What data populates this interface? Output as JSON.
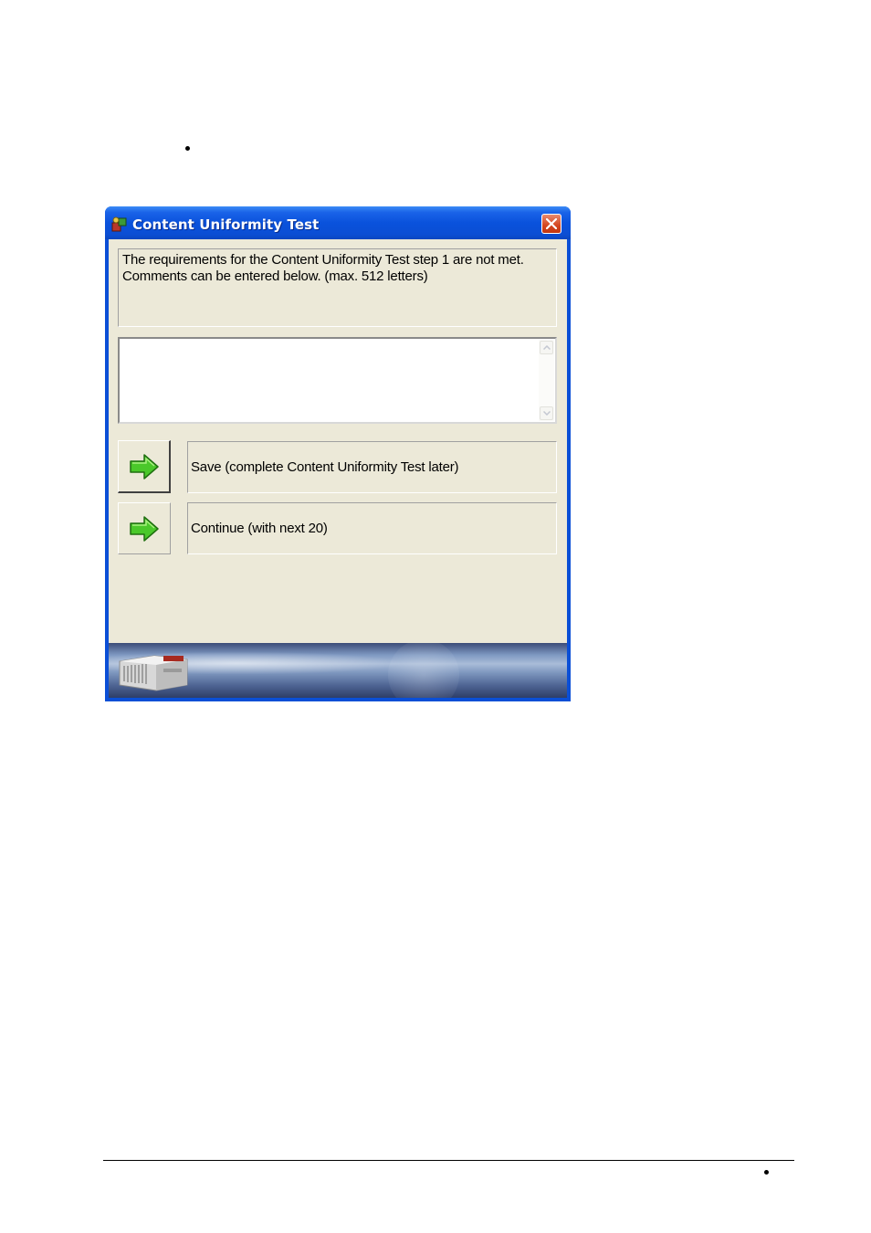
{
  "window": {
    "title": "Content Uniformity Test",
    "message": "The requirements for the Content Uniformity Test step 1 are not met. Comments can be entered below. (max. 512 letters)",
    "comment_value": "",
    "icons": {
      "app": "app-icon",
      "close": "close-icon",
      "action": "green-arrow-right-icon",
      "scroll_up": "scroll-up-arrow-icon",
      "scroll_down": "scroll-down-arrow-icon",
      "banner": "instrument-device-image"
    },
    "actions": {
      "save_label": "Save (complete Content Uniformity Test later)",
      "continue_label": "Continue (with next 20)"
    }
  },
  "colors": {
    "titlebar": "#0b4fd6",
    "client_background": "#ece9d8",
    "close_button": "#d4461e",
    "arrow_green": "#4ac82a"
  }
}
